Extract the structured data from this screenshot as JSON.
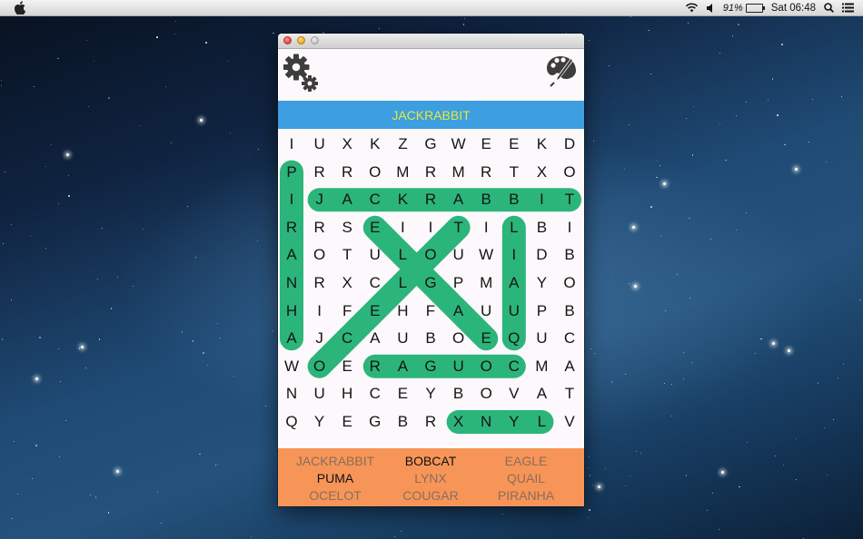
{
  "menubar": {
    "battery_percent": "91%",
    "clock": "Sat 06:48",
    "icons": [
      "apple-icon",
      "wifi-icon",
      "volume-icon",
      "battery-icon",
      "spotlight-icon",
      "notification-center-icon"
    ]
  },
  "window": {
    "traffic_lights": [
      "close",
      "minimize",
      "zoom"
    ],
    "toolbar": {
      "left_icon": "gears-icon",
      "right_icon": "palette-brush-icon"
    },
    "current_word": "JACKRABBIT",
    "colors": {
      "banner": "#3d9ee0",
      "banner_text": "#e4ea3c",
      "highlight": "#2bb57a",
      "word_panel": "#f79558",
      "found_word": "#8a6d5a",
      "pending_word": "#111111"
    },
    "grid": [
      [
        "I",
        "U",
        "X",
        "K",
        "Z",
        "G",
        "W",
        "E",
        "E",
        "K",
        "D"
      ],
      [
        "P",
        "R",
        "R",
        "O",
        "M",
        "R",
        "M",
        "R",
        "T",
        "X",
        "O"
      ],
      [
        "I",
        "J",
        "A",
        "C",
        "K",
        "R",
        "A",
        "B",
        "B",
        "I",
        "T"
      ],
      [
        "R",
        "R",
        "S",
        "E",
        "I",
        "I",
        "T",
        "I",
        "L",
        "B",
        "I"
      ],
      [
        "A",
        "O",
        "T",
        "U",
        "L",
        "O",
        "U",
        "W",
        "I",
        "D",
        "B"
      ],
      [
        "N",
        "R",
        "X",
        "C",
        "L",
        "G",
        "P",
        "M",
        "A",
        "Y",
        "O"
      ],
      [
        "H",
        "I",
        "F",
        "E",
        "H",
        "F",
        "A",
        "U",
        "U",
        "P",
        "B"
      ],
      [
        "A",
        "J",
        "C",
        "A",
        "U",
        "B",
        "O",
        "E",
        "Q",
        "U",
        "C"
      ],
      [
        "W",
        "O",
        "E",
        "R",
        "A",
        "G",
        "U",
        "O",
        "C",
        "M",
        "A"
      ],
      [
        "N",
        "U",
        "H",
        "C",
        "E",
        "Y",
        "B",
        "O",
        "V",
        "A",
        "T"
      ],
      [
        "Q",
        "Y",
        "E",
        "G",
        "B",
        "R",
        "X",
        "N",
        "Y",
        "L",
        "V"
      ]
    ],
    "found_paths": [
      {
        "word": "PIRANHA",
        "from": [
          1,
          0
        ],
        "to": [
          7,
          0
        ]
      },
      {
        "word": "JACKRABBIT",
        "from": [
          2,
          1
        ],
        "to": [
          2,
          10
        ]
      },
      {
        "word": "EAGLE",
        "from": [
          3,
          3
        ],
        "to": [
          7,
          7
        ]
      },
      {
        "word": "OCELOT",
        "from": [
          3,
          6
        ],
        "to": [
          8,
          1
        ]
      },
      {
        "word": "QUAIL",
        "from": [
          3,
          8
        ],
        "to": [
          7,
          8
        ]
      },
      {
        "word": "COUGAR",
        "from": [
          8,
          3
        ],
        "to": [
          8,
          8
        ]
      },
      {
        "word": "LYNX",
        "from": [
          10,
          6
        ],
        "to": [
          10,
          9
        ]
      }
    ],
    "word_list": [
      {
        "label": "JACKRABBIT",
        "found": true
      },
      {
        "label": "BOBCAT",
        "found": false
      },
      {
        "label": "EAGLE",
        "found": true
      },
      {
        "label": "PUMA",
        "found": false
      },
      {
        "label": "LYNX",
        "found": true
      },
      {
        "label": "QUAIL",
        "found": true
      },
      {
        "label": "OCELOT",
        "found": true
      },
      {
        "label": "COUGAR",
        "found": true
      },
      {
        "label": "PIRANHA",
        "found": true
      }
    ]
  }
}
